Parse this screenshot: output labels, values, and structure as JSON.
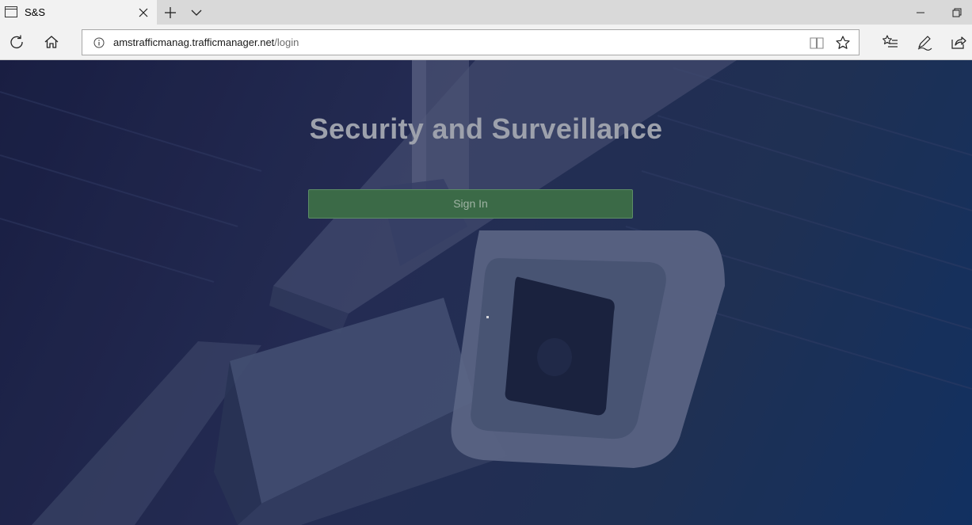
{
  "browser": {
    "tab": {
      "title": "S&S"
    },
    "address": {
      "url_host": "amstrafficmanag.trafficmanager.net",
      "url_path": "/login"
    },
    "icons": {
      "tab": "page-icon",
      "close": "close-icon",
      "new_tab": "plus-icon",
      "tab_list": "chevron-down-icon",
      "minimize": "minimize-icon",
      "restore": "restore-icon",
      "refresh": "refresh-icon",
      "home": "home-icon",
      "info": "info-icon",
      "reading_view": "book-icon",
      "favorite": "star-icon",
      "favorites_hub": "favorites-list-icon",
      "notes": "pen-icon",
      "share": "share-icon"
    }
  },
  "page": {
    "title": "Security and Surveillance",
    "signin_label": "Sign In",
    "colors": {
      "background": "#1f2b52",
      "title": "#9da1ac",
      "button": "#3b6a47",
      "button_text": "#9fb3a3"
    }
  }
}
